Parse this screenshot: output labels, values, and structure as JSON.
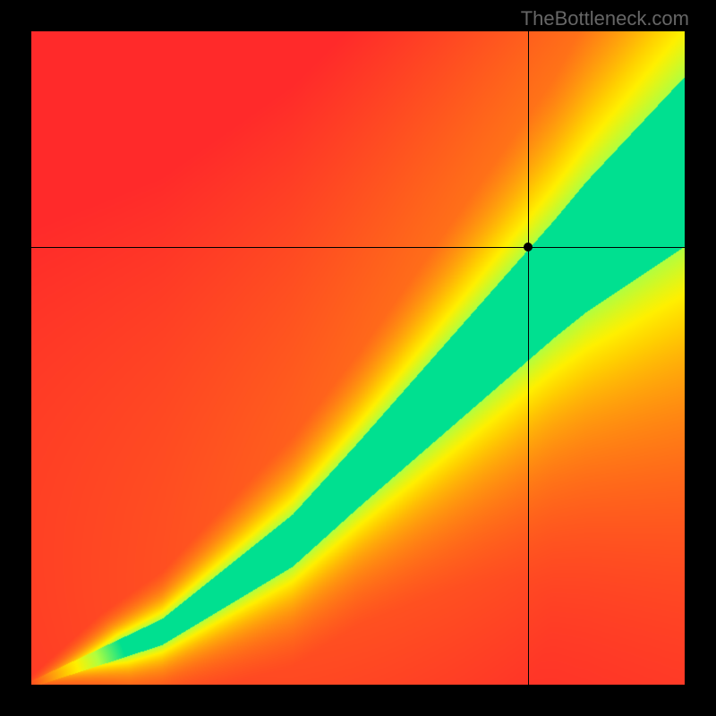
{
  "watermark": "TheBottleneck.com",
  "chart_data": {
    "type": "heatmap",
    "title": "",
    "xlabel": "",
    "ylabel": "",
    "xlim": [
      0,
      100
    ],
    "ylim": [
      0,
      100
    ],
    "crosshair": {
      "x": 76,
      "y": 67
    },
    "marker": {
      "x": 76,
      "y": 67
    },
    "colorscale": [
      {
        "value": 0.0,
        "color": "#ff2a2a"
      },
      {
        "value": 0.45,
        "color": "#ffd000"
      },
      {
        "value": 0.55,
        "color": "#fff000"
      },
      {
        "value": 0.75,
        "color": "#b0ff40"
      },
      {
        "value": 1.0,
        "color": "#00e090"
      }
    ],
    "description": "Smooth 2D heatmap; highest fitness (green) along a superlinear diagonal band that widens toward top-right. Lower-left corner is red. Upper-left region is red-orange, lower-right region is orange-red. A narrow yellow halo surrounds the green band.",
    "band": {
      "control_points_center": [
        {
          "x": 0,
          "y": 0
        },
        {
          "x": 20,
          "y": 8
        },
        {
          "x": 40,
          "y": 22
        },
        {
          "x": 55,
          "y": 37
        },
        {
          "x": 70,
          "y": 52
        },
        {
          "x": 85,
          "y": 67
        },
        {
          "x": 100,
          "y": 80
        }
      ],
      "halfwidth_at_x": [
        {
          "x": 0,
          "w": 0.5
        },
        {
          "x": 20,
          "w": 2
        },
        {
          "x": 50,
          "w": 5
        },
        {
          "x": 80,
          "w": 9
        },
        {
          "x": 100,
          "w": 13
        }
      ]
    }
  }
}
